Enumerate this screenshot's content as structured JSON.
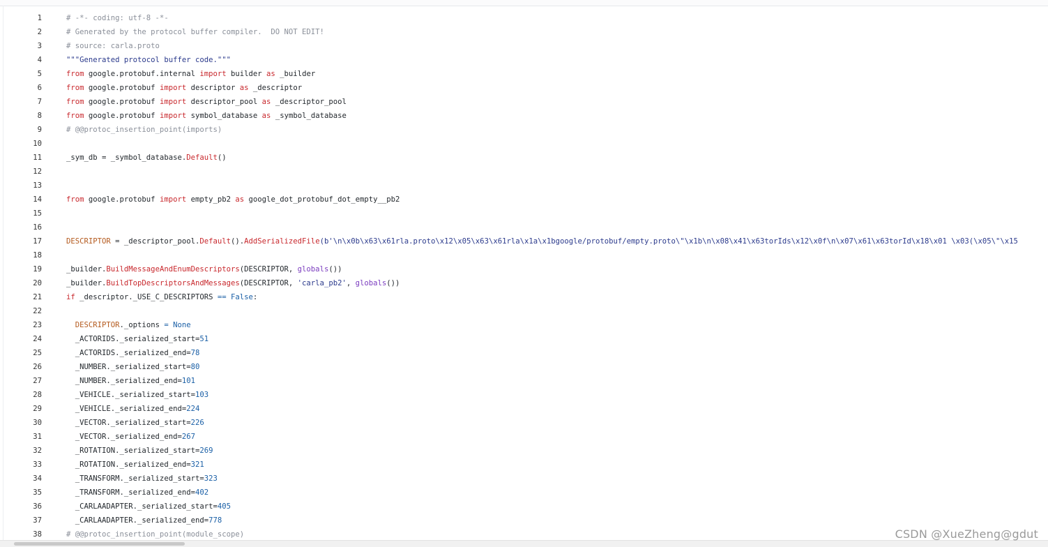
{
  "code": {
    "lines": [
      {
        "n": "1",
        "tokens": [
          [
            "comment",
            "# -*- coding: utf-8 -*-"
          ]
        ]
      },
      {
        "n": "2",
        "tokens": [
          [
            "comment",
            "# Generated by the protocol buffer compiler.  DO NOT EDIT!"
          ]
        ]
      },
      {
        "n": "3",
        "tokens": [
          [
            "comment",
            "# source: carla.proto"
          ]
        ]
      },
      {
        "n": "4",
        "tokens": [
          [
            "str",
            "\"\"\"Generated protocol buffer code.\"\"\""
          ]
        ]
      },
      {
        "n": "5",
        "tokens": [
          [
            "kw",
            "from"
          ],
          [
            "plain",
            " google.protobuf.internal "
          ],
          [
            "kw",
            "import"
          ],
          [
            "plain",
            " builder "
          ],
          [
            "kw",
            "as"
          ],
          [
            "plain",
            " _builder"
          ]
        ]
      },
      {
        "n": "6",
        "tokens": [
          [
            "kw",
            "from"
          ],
          [
            "plain",
            " google.protobuf "
          ],
          [
            "kw",
            "import"
          ],
          [
            "plain",
            " descriptor "
          ],
          [
            "kw",
            "as"
          ],
          [
            "plain",
            " _descriptor"
          ]
        ]
      },
      {
        "n": "7",
        "tokens": [
          [
            "kw",
            "from"
          ],
          [
            "plain",
            " google.protobuf "
          ],
          [
            "kw",
            "import"
          ],
          [
            "plain",
            " descriptor_pool "
          ],
          [
            "kw",
            "as"
          ],
          [
            "plain",
            " _descriptor_pool"
          ]
        ]
      },
      {
        "n": "8",
        "tokens": [
          [
            "kw",
            "from"
          ],
          [
            "plain",
            " google.protobuf "
          ],
          [
            "kw",
            "import"
          ],
          [
            "plain",
            " symbol_database "
          ],
          [
            "kw",
            "as"
          ],
          [
            "plain",
            " _symbol_database"
          ]
        ]
      },
      {
        "n": "9",
        "tokens": [
          [
            "comment",
            "# @@protoc_insertion_point(imports)"
          ]
        ]
      },
      {
        "n": "10",
        "tokens": []
      },
      {
        "n": "11",
        "tokens": [
          [
            "plain",
            "_sym_db = _symbol_database."
          ],
          [
            "call",
            "Default"
          ],
          [
            "plain",
            "()"
          ]
        ]
      },
      {
        "n": "12",
        "tokens": []
      },
      {
        "n": "13",
        "tokens": []
      },
      {
        "n": "14",
        "tokens": [
          [
            "kw",
            "from"
          ],
          [
            "plain",
            " google.protobuf "
          ],
          [
            "kw",
            "import"
          ],
          [
            "plain",
            " empty_pb2 "
          ],
          [
            "kw",
            "as"
          ],
          [
            "plain",
            " google_dot_protobuf_dot_empty__pb2"
          ]
        ]
      },
      {
        "n": "15",
        "tokens": []
      },
      {
        "n": "16",
        "tokens": []
      },
      {
        "n": "17",
        "tokens": [
          [
            "ident",
            "DESCRIPTOR"
          ],
          [
            "plain",
            " = _descriptor_pool."
          ],
          [
            "call",
            "Default"
          ],
          [
            "plain",
            "()."
          ],
          [
            "call",
            "AddSerializedFile"
          ],
          [
            "str",
            "(b'\\n\\x0b\\x63\\x61rla.proto\\x12\\x05\\x63\\x61rla\\x1a\\x1bgoogle/protobuf/empty.proto\\\"\\x1b\\n\\x08\\x41\\x63torIds\\x12\\x0f\\n\\x07\\x61\\x63torId\\x18\\x01 \\x03(\\x05\\\"\\x15"
          ]
        ]
      },
      {
        "n": "18",
        "tokens": []
      },
      {
        "n": "19",
        "tokens": [
          [
            "plain",
            "_builder."
          ],
          [
            "call",
            "BuildMessageAndEnumDescriptors"
          ],
          [
            "plain",
            "(DESCRIPTOR, "
          ],
          [
            "builtin",
            "globals"
          ],
          [
            "plain",
            "())"
          ]
        ]
      },
      {
        "n": "20",
        "tokens": [
          [
            "plain",
            "_builder."
          ],
          [
            "call",
            "BuildTopDescriptorsAndMessages"
          ],
          [
            "plain",
            "(DESCRIPTOR, "
          ],
          [
            "str",
            "'carla_pb2'"
          ],
          [
            "plain",
            ", "
          ],
          [
            "builtin",
            "globals"
          ],
          [
            "plain",
            "())"
          ]
        ]
      },
      {
        "n": "21",
        "tokens": [
          [
            "kw",
            "if"
          ],
          [
            "plain",
            " _descriptor._USE_C_DESCRIPTORS "
          ],
          [
            "const",
            "=="
          ],
          [
            "plain",
            " "
          ],
          [
            "const",
            "False"
          ],
          [
            "plain",
            ":"
          ]
        ]
      },
      {
        "n": "22",
        "tokens": []
      },
      {
        "n": "23",
        "tokens": [
          [
            "plain",
            "  "
          ],
          [
            "ident",
            "DESCRIPTOR"
          ],
          [
            "plain",
            "._options "
          ],
          [
            "const",
            "="
          ],
          [
            "plain",
            " "
          ],
          [
            "const",
            "None"
          ]
        ]
      },
      {
        "n": "24",
        "tokens": [
          [
            "plain",
            "  _ACTORIDS._serialized_start="
          ],
          [
            "num",
            "51"
          ]
        ]
      },
      {
        "n": "25",
        "tokens": [
          [
            "plain",
            "  _ACTORIDS._serialized_end="
          ],
          [
            "num",
            "78"
          ]
        ]
      },
      {
        "n": "26",
        "tokens": [
          [
            "plain",
            "  _NUMBER._serialized_start="
          ],
          [
            "num",
            "80"
          ]
        ]
      },
      {
        "n": "27",
        "tokens": [
          [
            "plain",
            "  _NUMBER._serialized_end="
          ],
          [
            "num",
            "101"
          ]
        ]
      },
      {
        "n": "28",
        "tokens": [
          [
            "plain",
            "  _VEHICLE._serialized_start="
          ],
          [
            "num",
            "103"
          ]
        ]
      },
      {
        "n": "29",
        "tokens": [
          [
            "plain",
            "  _VEHICLE._serialized_end="
          ],
          [
            "num",
            "224"
          ]
        ]
      },
      {
        "n": "30",
        "tokens": [
          [
            "plain",
            "  _VECTOR._serialized_start="
          ],
          [
            "num",
            "226"
          ]
        ]
      },
      {
        "n": "31",
        "tokens": [
          [
            "plain",
            "  _VECTOR._serialized_end="
          ],
          [
            "num",
            "267"
          ]
        ]
      },
      {
        "n": "32",
        "tokens": [
          [
            "plain",
            "  _ROTATION._serialized_start="
          ],
          [
            "num",
            "269"
          ]
        ]
      },
      {
        "n": "33",
        "tokens": [
          [
            "plain",
            "  _ROTATION._serialized_end="
          ],
          [
            "num",
            "321"
          ]
        ]
      },
      {
        "n": "34",
        "tokens": [
          [
            "plain",
            "  _TRANSFORM._serialized_start="
          ],
          [
            "num",
            "323"
          ]
        ]
      },
      {
        "n": "35",
        "tokens": [
          [
            "plain",
            "  _TRANSFORM._serialized_end="
          ],
          [
            "num",
            "402"
          ]
        ]
      },
      {
        "n": "36",
        "tokens": [
          [
            "plain",
            "  _CARLAADAPTER._serialized_start="
          ],
          [
            "num",
            "405"
          ]
        ]
      },
      {
        "n": "37",
        "tokens": [
          [
            "plain",
            "  _CARLAADAPTER._serialized_end="
          ],
          [
            "num",
            "778"
          ]
        ]
      },
      {
        "n": "38",
        "tokens": [
          [
            "comment",
            "# @@protoc_insertion_point(module_scope)"
          ]
        ]
      }
    ]
  },
  "watermark": {
    "text": "CSDN @XueZheng@gdut"
  },
  "colors": {
    "comment": "#8a8f99",
    "keyword": "#c8282d",
    "identifier": "#b45a1e",
    "number": "#1a5fa6",
    "builtin": "#7b3cbf",
    "string": "#2b3a8c"
  }
}
